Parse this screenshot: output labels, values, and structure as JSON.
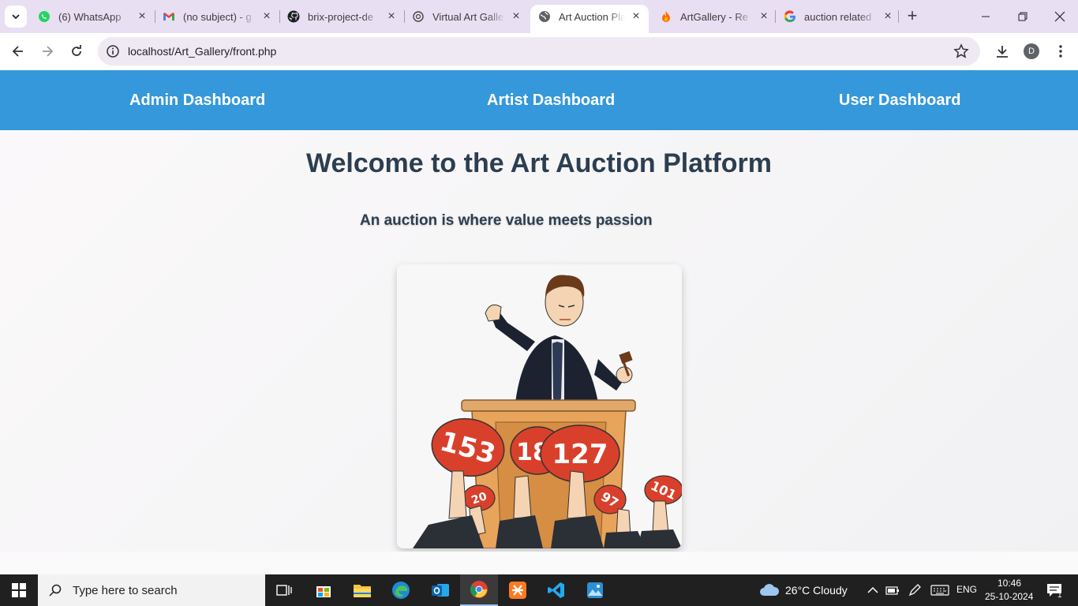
{
  "browser": {
    "tabs": [
      {
        "title": "(6) WhatsApp",
        "icon": "whatsapp-icon",
        "active": false
      },
      {
        "title": "(no subject) - g",
        "icon": "gmail-icon",
        "active": false
      },
      {
        "title": "brix-project-de",
        "icon": "github-icon",
        "active": false
      },
      {
        "title": "Virtual Art Galle",
        "icon": "chatgpt-icon",
        "active": false
      },
      {
        "title": "Art Auction Pla",
        "icon": "globe-icon",
        "active": true
      },
      {
        "title": "ArtGallery - Re",
        "icon": "flame-icon",
        "active": false
      },
      {
        "title": "auction related",
        "icon": "google-icon",
        "active": false
      }
    ],
    "url": "localhost/Art_Gallery/front.php",
    "profile_initial": "D"
  },
  "page": {
    "nav": {
      "admin": "Admin Dashboard",
      "artist": "Artist Dashboard",
      "user": "User Dashboard"
    },
    "heading": "Welcome to the Art Auction Platform",
    "subheading": "An auction is where value meets passion",
    "paddles": [
      "153",
      "18",
      "127",
      "20",
      "97",
      "101"
    ]
  },
  "taskbar": {
    "search_placeholder": "Type here to search",
    "weather": "26°C  Cloudy",
    "language": "ENG",
    "time": "10:46",
    "date": "25-10-2024",
    "notification_count": "1"
  },
  "colors": {
    "nav_bg": "#3498db",
    "heading": "#2c3e50",
    "tabstrip": "#e9dff2"
  }
}
